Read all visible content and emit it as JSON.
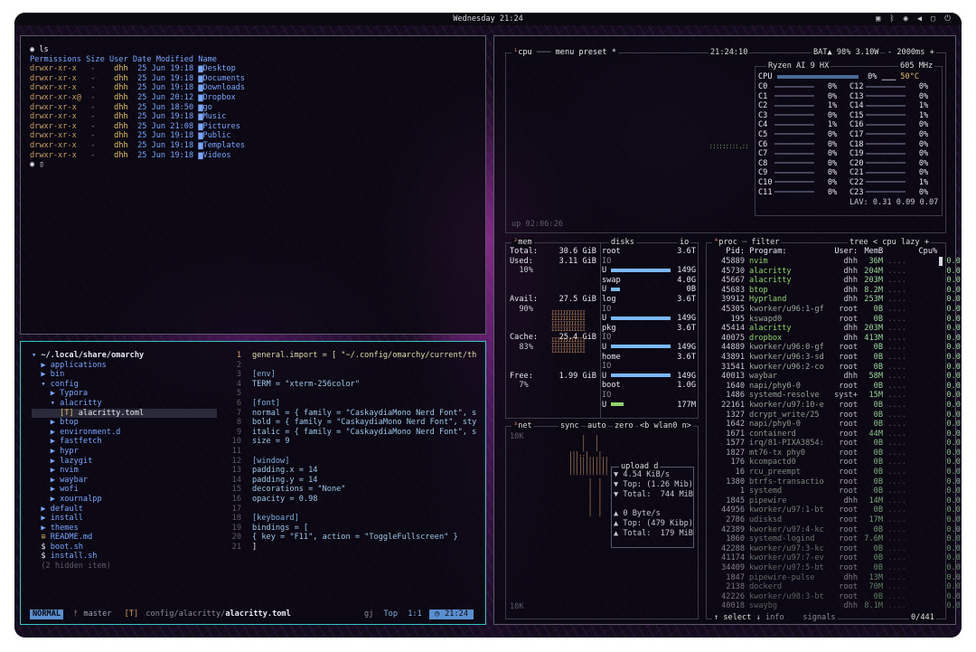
{
  "topbar": {
    "clock": "Wednesday 21:24",
    "tray_icons": [
      "display-icon",
      "bluetooth-icon",
      "wifi-icon",
      "volume-icon",
      "monitor-icon",
      "power-icon"
    ]
  },
  "terminal": {
    "cmd_prompt": "ls",
    "header": "Permissions Size User Date Modified Name",
    "rows": [
      {
        "perm": "drwxr-xr-x",
        "size": "-",
        "user": "dhh",
        "date": "25 Jun 19:18",
        "name": "Desktop"
      },
      {
        "perm": "drwxr-xr-x",
        "size": "-",
        "user": "dhh",
        "date": "25 Jun 19:18",
        "name": "Documents"
      },
      {
        "perm": "drwxr-xr-x",
        "size": "-",
        "user": "dhh",
        "date": "25 Jun 19:18",
        "name": "Downloads"
      },
      {
        "perm": "drwxr-xr-x@",
        "size": "-",
        "user": "dhh",
        "date": "25 Jun 20:12",
        "name": "Dropbox"
      },
      {
        "perm": "drwxr-xr-x",
        "size": "-",
        "user": "dhh",
        "date": "25 Jun 18:50",
        "name": "go"
      },
      {
        "perm": "drwxr-xr-x",
        "size": "-",
        "user": "dhh",
        "date": "25 Jun 19:18",
        "name": "Music"
      },
      {
        "perm": "drwxr-xr-x",
        "size": "-",
        "user": "dhh",
        "date": "25 Jun 21:08",
        "name": "Pictures"
      },
      {
        "perm": "drwxr-xr-x",
        "size": "-",
        "user": "dhh",
        "date": "25 Jun 19:18",
        "name": "Public"
      },
      {
        "perm": "drwxr-xr-x",
        "size": "-",
        "user": "dhh",
        "date": "25 Jun 19:18",
        "name": "Templates"
      },
      {
        "perm": "drwxr-xr-x",
        "size": "-",
        "user": "dhh",
        "date": "25 Jun 19:18",
        "name": "Videos"
      }
    ]
  },
  "tree": {
    "root": "~/.local/share/omarchy",
    "items": [
      {
        "t": "applications",
        "d": 1,
        "k": "dir"
      },
      {
        "t": "bin",
        "d": 1,
        "k": "dir"
      },
      {
        "t": "config",
        "d": 1,
        "k": "open"
      },
      {
        "t": "Typora",
        "d": 2,
        "k": "dir"
      },
      {
        "t": "alacritty",
        "d": 2,
        "k": "open"
      },
      {
        "t": "alacritty.toml",
        "d": 3,
        "k": "file"
      },
      {
        "t": "btop",
        "d": 2,
        "k": "dir"
      },
      {
        "t": "environment.d",
        "d": 2,
        "k": "dir"
      },
      {
        "t": "fastfetch",
        "d": 2,
        "k": "dir"
      },
      {
        "t": "hypr",
        "d": 2,
        "k": "dir"
      },
      {
        "t": "lazygit",
        "d": 2,
        "k": "dir"
      },
      {
        "t": "nvim",
        "d": 2,
        "k": "dir"
      },
      {
        "t": "waybar",
        "d": 2,
        "k": "dir"
      },
      {
        "t": "wofi",
        "d": 2,
        "k": "dir"
      },
      {
        "t": "xournalpp",
        "d": 2,
        "k": "dir"
      },
      {
        "t": "default",
        "d": 1,
        "k": "dir"
      },
      {
        "t": "install",
        "d": 1,
        "k": "dir"
      },
      {
        "t": "themes",
        "d": 1,
        "k": "dir"
      },
      {
        "t": "README.md",
        "d": 1,
        "k": "md"
      },
      {
        "t": "boot.sh",
        "d": 1,
        "k": "sh"
      },
      {
        "t": "install.sh",
        "d": 1,
        "k": "sh"
      },
      {
        "t": "(2 hidden item)",
        "d": 1,
        "k": "hidden"
      }
    ]
  },
  "editor": {
    "lines": [
      "general.import = [ \"~/.config/omarchy/current/th",
      "",
      "[env]",
      "TERM = \"xterm-256color\"",
      "",
      "[font]",
      "normal = { family = \"CaskaydiaMono Nerd Font\", s",
      "bold = { family = \"CaskaydiaMono Nerd Font\", sty",
      "italic = { family = \"CaskaydiaMono Nerd Font\", s",
      "size = 9",
      "",
      "[window]",
      "padding.x = 14",
      "padding.y = 14",
      "decorations = \"None\"",
      "opacity = 0.98",
      "",
      "[keyboard]",
      "bindings = [",
      "{ key = \"F11\", action = \"ToggleFullscreen\" }",
      "]"
    ],
    "line_numbers": [
      "1",
      "1",
      "2",
      "3",
      "4",
      "5",
      "6",
      "7",
      "8",
      "9",
      "10",
      "11",
      "12",
      "13",
      "14",
      "15",
      "16",
      "17",
      "18",
      "19",
      "20",
      "21"
    ],
    "status": {
      "mode": "NORMAL",
      "branch": "master",
      "path_dir": "config/alacritty/",
      "path_file": "alacritty.toml",
      "cmd": "gj",
      "pos": "Top",
      "loc": "1:1",
      "time": "21:24"
    }
  },
  "btop": {
    "cpu_header": {
      "menu": "menu",
      "preset": "preset",
      "time": "21:24:10",
      "bat": "BAT▲ 98% 3.10W",
      "interval": "2000ms"
    },
    "cpu_model": "Ryzen AI 9 HX",
    "freq": "605 MHz",
    "cpu_total": "0%",
    "temp": "50°C",
    "uptime": "up 02:06:26",
    "lav": "LAV: 0.31 0.09 0.07",
    "cores_left": [
      [
        "C0",
        "0%"
      ],
      [
        "C1",
        "0%"
      ],
      [
        "C2",
        "1%"
      ],
      [
        "C3",
        "0%"
      ],
      [
        "C4",
        "1%"
      ],
      [
        "C5",
        "0%"
      ],
      [
        "C6",
        "0%"
      ],
      [
        "C7",
        "0%"
      ],
      [
        "C8",
        "0%"
      ],
      [
        "C9",
        "0%"
      ],
      [
        "C10",
        "0%"
      ],
      [
        "C11",
        "0%"
      ]
    ],
    "cores_right": [
      [
        "C12",
        "0%"
      ],
      [
        "C13",
        "0%"
      ],
      [
        "C14",
        "1%"
      ],
      [
        "C15",
        "1%"
      ],
      [
        "C16",
        "0%"
      ],
      [
        "C17",
        "0%"
      ],
      [
        "C18",
        "0%"
      ],
      [
        "C19",
        "0%"
      ],
      [
        "C20",
        "0%"
      ],
      [
        "C21",
        "0%"
      ],
      [
        "C22",
        "1%"
      ],
      [
        "C23",
        "0%"
      ]
    ],
    "mem": {
      "title": "mem",
      "total": "30.6 GiB",
      "used": "3.11 GiB",
      "used_pct": "10%",
      "avail": "27.5 GiB",
      "avail_pct": "90%",
      "cache": "25.4 GiB",
      "cache_pct": "83%",
      "free": "1.99 GiB",
      "free_pct": "7%"
    },
    "disks": [
      {
        "name": "root",
        "size": "3.6T",
        "used": "149G"
      },
      {
        "name": "swap",
        "size": "4.0G",
        "used": "0B"
      },
      {
        "name": "log",
        "size": "3.6T",
        "used": "149G"
      },
      {
        "name": "pkg",
        "size": "3.6T",
        "used": "149G"
      },
      {
        "name": "home",
        "size": "3.6T",
        "used": "149G"
      },
      {
        "name": "boot",
        "size": "1.0G",
        "used": "177M"
      }
    ],
    "net": {
      "title": "net",
      "sync": "sync",
      "auto": "auto",
      "zero": "zero",
      "iface": "wlan0",
      "scale_top": "10K",
      "scale_bottom": "10K",
      "upload": "upload",
      "up_rate": "4.54 KiB/s",
      "up_top": "Top: (1.26 Mib)",
      "up_total": "Total:  744 MiB",
      "down_rate": "0 Byte/s",
      "down_top": "Top: (479 Kibp)",
      "down_total": "Total:  179 MiB"
    },
    "proc": {
      "title": "proc",
      "filter": "filter",
      "tree": "tree",
      "cpu": "cpu",
      "lazy": "lazy",
      "hdr_pid": "Pid:",
      "hdr_prog": "Program:",
      "hdr_user": "User:",
      "hdr_mem": "MemB",
      "hdr_cpu": "Cpu%",
      "rows": [
        [
          "45889",
          "nvim",
          "dhh",
          "36M",
          "0.0"
        ],
        [
          "45730",
          "alacritty",
          "dhh",
          "204M",
          "0.0"
        ],
        [
          "45667",
          "alacritty",
          "dhh",
          "203M",
          "0.0"
        ],
        [
          "45683",
          "btop",
          "dhh",
          "8.2M",
          "0.0"
        ],
        [
          "39912",
          "Hyprland",
          "dhh",
          "253M",
          "0.0"
        ],
        [
          "45305",
          "kworker/u96:1-gf",
          "root",
          "0B",
          "0.0"
        ],
        [
          "195",
          "kswapd0",
          "root",
          "0B",
          "0.0"
        ],
        [
          "45414",
          "alacritty",
          "dhh",
          "203M",
          "0.0"
        ],
        [
          "40075",
          "dropbox",
          "dhh",
          "413M",
          "0.0"
        ],
        [
          "44889",
          "kworker/u96:0-gf",
          "root",
          "0B",
          "0.0"
        ],
        [
          "43891",
          "kworker/u96:3-sd",
          "root",
          "0B",
          "0.0"
        ],
        [
          "31541",
          "kworker/u96:2-co",
          "root",
          "0B",
          "0.0"
        ],
        [
          "40013",
          "waybar",
          "dhh",
          "58M",
          "0.0"
        ],
        [
          "1640",
          "napi/phy0-0",
          "root",
          "0B",
          "0.0"
        ],
        [
          "1486",
          "systemd-resolve",
          "syst+",
          "15M",
          "0.0"
        ],
        [
          "22161",
          "kworker/u97:10-e",
          "root",
          "0B",
          "0.0"
        ],
        [
          "1327",
          "dcrypt_write/25",
          "root",
          "0B",
          "0.0"
        ],
        [
          "1642",
          "napi/phy0-0",
          "root",
          "0B",
          "0.0"
        ],
        [
          "1671",
          "containerd",
          "root",
          "44M",
          "0.0"
        ],
        [
          "1577",
          "irq/81-PIXA3854:",
          "root",
          "0B",
          "0.0"
        ],
        [
          "1827",
          "mt76-tx phy0",
          "root",
          "0B",
          "0.0"
        ],
        [
          "176",
          "kcompactd0",
          "root",
          "0B",
          "0.0"
        ],
        [
          "16",
          "rcu_preempt",
          "root",
          "0B",
          "0.0"
        ],
        [
          "1380",
          "btrfs-transactio",
          "root",
          "0B",
          "0.0"
        ],
        [
          "1",
          "systemd",
          "root",
          "0B",
          "0.0"
        ],
        [
          "1845",
          "pipewire",
          "dhh",
          "14M",
          "0.0"
        ],
        [
          "44956",
          "kworker/u97:1-bt",
          "root",
          "0B",
          "0.0"
        ],
        [
          "2786",
          "udisksd",
          "root",
          "17M",
          "0.0"
        ],
        [
          "42389",
          "kworker/u97:4-kc",
          "root",
          "0B",
          "0.0"
        ],
        [
          "1860",
          "systemd-logind",
          "root",
          "7.6M",
          "0.0"
        ],
        [
          "42288",
          "kworker/u97:3-kc",
          "root",
          "0B",
          "0.0"
        ],
        [
          "41174",
          "kworker/u97:7-ev",
          "root",
          "0B",
          "0.0"
        ],
        [
          "34409",
          "kworker/u97:5-bt",
          "root",
          "0B",
          "0.0"
        ],
        [
          "1847",
          "pipewire-pulse",
          "dhh",
          "13M",
          "0.0"
        ],
        [
          "2138",
          "dockerd",
          "root",
          "70M",
          "0.0"
        ],
        [
          "42226",
          "kworker/u98:3-bt",
          "root",
          "0B",
          "0.0"
        ],
        [
          "40018",
          "swaybg",
          "dhh",
          "8.1M",
          "0.0"
        ]
      ],
      "footer_select": "select",
      "footer_info": "info",
      "footer_signals": "signals",
      "count": "0/441"
    }
  }
}
